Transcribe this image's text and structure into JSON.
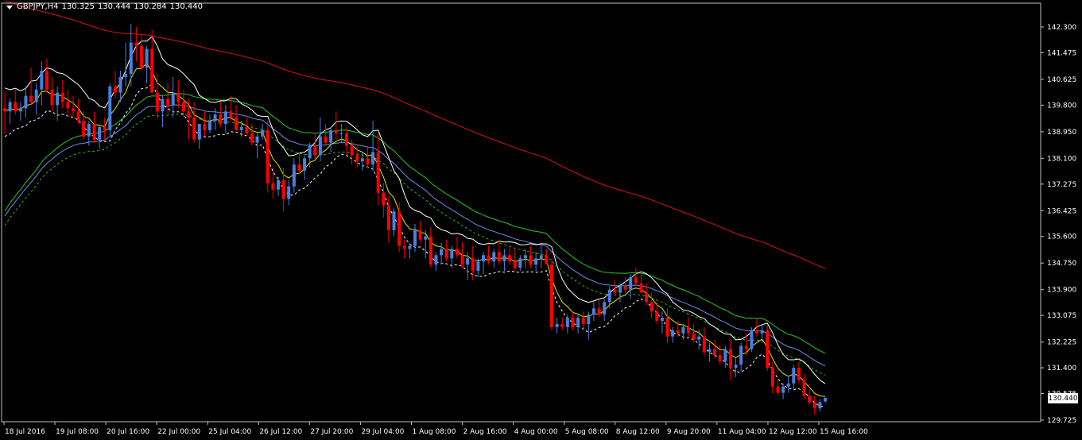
{
  "header": {
    "symbol": "GBPJPY,H4",
    "open": "130.325",
    "high": "130.444",
    "low": "130.284",
    "close": "130.440"
  },
  "current_price": "130.440",
  "chart_data": {
    "type": "candlestick",
    "y_ticks": [
      "142.300",
      "141.475",
      "140.625",
      "139.800",
      "138.950",
      "138.100",
      "137.275",
      "136.425",
      "135.600",
      "134.750",
      "133.900",
      "133.075",
      "132.225",
      "131.400",
      "130.575",
      "129.725"
    ],
    "x_ticks": [
      "18 Jul 2016",
      "19 Jul 08:00",
      "20 Jul 16:00",
      "22 Jul 00:00",
      "25 Jul 04:00",
      "26 Jul 12:00",
      "27 Jul 20:00",
      "29 Jul 04:00",
      "1 Aug 08:00",
      "2 Aug 16:00",
      "4 Aug 00:00",
      "5 Aug 08:00",
      "8 Aug 12:00",
      "9 Aug 20:00",
      "11 Aug 04:00",
      "12 Aug 12:00",
      "15 Aug 16:00"
    ],
    "ylim": [
      129.725,
      142.3
    ],
    "colors": {
      "bull": "#4a7fe0",
      "bear": "#ff0000",
      "ma_red": "#e01010",
      "ma_green": "#22cc22",
      "ma_blue": "#6a8fe0",
      "ma_green_dashed": "#22bb22",
      "ma_white": "#ffffff",
      "ma_yellow": "#e6e600",
      "ma_white_dashed": "#ffffff",
      "background": "#000000",
      "axis": "#ffffff"
    },
    "candles": [
      [
        139.7,
        140.2,
        138.9,
        139.6
      ],
      [
        139.6,
        140.0,
        139.2,
        139.9
      ],
      [
        139.9,
        140.3,
        139.5,
        139.6
      ],
      [
        139.6,
        139.9,
        139.3,
        139.7
      ],
      [
        139.7,
        140.4,
        139.4,
        140.1
      ],
      [
        140.1,
        141.0,
        139.8,
        139.9
      ],
      [
        139.9,
        140.5,
        139.5,
        140.3
      ],
      [
        140.3,
        141.2,
        139.8,
        140.9
      ],
      [
        140.9,
        141.3,
        140.2,
        140.3
      ],
      [
        140.3,
        140.7,
        139.6,
        139.8
      ],
      [
        139.8,
        140.4,
        139.3,
        140.2
      ],
      [
        140.2,
        140.6,
        139.7,
        139.9
      ],
      [
        139.9,
        140.3,
        139.4,
        139.7
      ],
      [
        139.7,
        140.1,
        139.4,
        139.6
      ],
      [
        139.6,
        140.0,
        139.2,
        139.3
      ],
      [
        139.3,
        139.6,
        138.7,
        138.8
      ],
      [
        138.8,
        139.3,
        138.5,
        139.2
      ],
      [
        139.2,
        139.6,
        138.6,
        138.7
      ],
      [
        138.7,
        139.2,
        138.4,
        139.1
      ],
      [
        139.1,
        139.4,
        138.7,
        139.0
      ],
      [
        139.0,
        140.5,
        138.8,
        140.4
      ],
      [
        140.4,
        140.9,
        140.0,
        140.2
      ],
      [
        140.2,
        140.9,
        139.9,
        140.7
      ],
      [
        140.7,
        141.8,
        140.4,
        140.8
      ],
      [
        140.8,
        142.4,
        140.4,
        141.8
      ],
      [
        141.8,
        142.3,
        141.2,
        141.7
      ],
      [
        141.7,
        142.1,
        140.9,
        141.0
      ],
      [
        141.0,
        141.7,
        140.5,
        141.6
      ],
      [
        141.6,
        142.2,
        140.9,
        140.2
      ],
      [
        140.2,
        140.8,
        139.4,
        139.6
      ],
      [
        139.6,
        140.1,
        139.1,
        140.0
      ],
      [
        140.0,
        140.5,
        139.5,
        139.8
      ],
      [
        139.8,
        140.7,
        139.4,
        140.2
      ],
      [
        140.2,
        140.6,
        139.7,
        139.9
      ],
      [
        139.9,
        140.3,
        139.4,
        139.6
      ],
      [
        139.6,
        140.0,
        138.7,
        139.4
      ],
      [
        139.4,
        139.9,
        138.6,
        138.7
      ],
      [
        138.7,
        139.1,
        138.4,
        139.2
      ],
      [
        139.2,
        139.6,
        138.8,
        139.0
      ],
      [
        139.0,
        139.5,
        138.9,
        139.3
      ],
      [
        139.3,
        139.7,
        139.0,
        139.5
      ],
      [
        139.5,
        139.9,
        139.1,
        139.2
      ],
      [
        139.2,
        139.8,
        138.9,
        139.6
      ],
      [
        139.6,
        140.1,
        139.3,
        139.4
      ],
      [
        139.4,
        139.8,
        139.0,
        139.0
      ],
      [
        139.0,
        139.3,
        138.8,
        139.1
      ],
      [
        139.1,
        139.4,
        138.8,
        138.9
      ],
      [
        138.9,
        139.2,
        138.5,
        138.6
      ],
      [
        138.6,
        138.9,
        138.1,
        138.8
      ],
      [
        138.8,
        139.2,
        138.7,
        139.0
      ],
      [
        139.0,
        139.3,
        137.0,
        137.3
      ],
      [
        137.3,
        137.8,
        136.8,
        137.1
      ],
      [
        137.1,
        137.5,
        136.9,
        137.4
      ],
      [
        137.4,
        137.8,
        136.4,
        136.8
      ],
      [
        136.8,
        137.4,
        136.6,
        137.2
      ],
      [
        137.2,
        138.1,
        137.0,
        137.9
      ],
      [
        137.9,
        138.3,
        137.6,
        137.7
      ],
      [
        137.7,
        138.2,
        137.4,
        138.1
      ],
      [
        138.1,
        138.6,
        137.8,
        138.5
      ],
      [
        138.5,
        138.9,
        138.0,
        138.2
      ],
      [
        138.2,
        139.4,
        138.0,
        138.8
      ],
      [
        138.8,
        139.2,
        138.5,
        138.6
      ],
      [
        138.6,
        139.1,
        138.3,
        139.0
      ],
      [
        139.0,
        139.6,
        138.7,
        138.9
      ],
      [
        138.9,
        139.2,
        138.6,
        138.9
      ],
      [
        138.9,
        139.1,
        138.2,
        138.5
      ],
      [
        138.5,
        138.7,
        137.9,
        138.2
      ],
      [
        138.2,
        138.5,
        137.8,
        138.0
      ],
      [
        138.0,
        138.3,
        137.7,
        138.1
      ],
      [
        138.1,
        138.5,
        137.8,
        137.9
      ],
      [
        137.9,
        139.3,
        137.7,
        138.3
      ],
      [
        138.3,
        138.9,
        136.6,
        137.0
      ],
      [
        137.0,
        137.3,
        136.2,
        136.6
      ],
      [
        136.6,
        136.9,
        135.4,
        135.8
      ],
      [
        135.8,
        136.5,
        135.6,
        136.4
      ],
      [
        136.4,
        136.7,
        135.1,
        135.3
      ],
      [
        135.3,
        135.5,
        134.9,
        135.2
      ],
      [
        135.2,
        135.4,
        134.9,
        135.3
      ],
      [
        135.3,
        136.0,
        135.1,
        135.8
      ],
      [
        135.8,
        136.1,
        135.4,
        135.5
      ],
      [
        135.5,
        135.8,
        134.9,
        135.6
      ],
      [
        135.6,
        135.9,
        134.6,
        134.7
      ],
      [
        134.7,
        135.1,
        134.5,
        135.0
      ],
      [
        135.0,
        135.4,
        134.7,
        135.2
      ],
      [
        135.2,
        135.5,
        134.8,
        134.9
      ],
      [
        134.9,
        135.3,
        134.6,
        135.2
      ],
      [
        135.2,
        135.6,
        134.9,
        135.0
      ],
      [
        135.0,
        135.4,
        134.6,
        134.7
      ],
      [
        134.7,
        135.1,
        134.2,
        134.9
      ],
      [
        134.9,
        135.3,
        134.2,
        134.5
      ],
      [
        134.5,
        134.9,
        134.3,
        134.8
      ],
      [
        134.8,
        135.1,
        134.4,
        135.0
      ],
      [
        135.0,
        135.3,
        134.7,
        134.8
      ],
      [
        134.8,
        135.2,
        134.6,
        135.1
      ],
      [
        135.1,
        135.5,
        134.7,
        134.8
      ],
      [
        134.8,
        135.2,
        134.5,
        135.0
      ],
      [
        135.0,
        135.3,
        134.7,
        134.8
      ],
      [
        134.8,
        135.2,
        134.5,
        134.6
      ],
      [
        134.6,
        135.0,
        134.5,
        134.9
      ],
      [
        134.9,
        135.2,
        134.6,
        135.0
      ],
      [
        135.0,
        135.3,
        134.6,
        134.7
      ],
      [
        134.7,
        135.1,
        134.5,
        134.9
      ],
      [
        134.9,
        135.3,
        134.6,
        135.0
      ],
      [
        135.0,
        135.2,
        134.7,
        134.7
      ],
      [
        134.7,
        134.9,
        132.6,
        132.7
      ],
      [
        132.7,
        133.0,
        132.5,
        132.8
      ],
      [
        132.8,
        133.0,
        132.6,
        132.7
      ],
      [
        132.7,
        133.1,
        132.5,
        133.0
      ],
      [
        133.0,
        133.2,
        132.6,
        132.7
      ],
      [
        132.7,
        133.1,
        132.5,
        133.0
      ],
      [
        133.0,
        133.2,
        132.6,
        132.8
      ],
      [
        132.8,
        133.2,
        132.3,
        133.1
      ],
      [
        133.1,
        133.5,
        132.9,
        133.3
      ],
      [
        133.3,
        133.6,
        133.0,
        133.1
      ],
      [
        133.1,
        133.6,
        132.9,
        133.5
      ],
      [
        133.5,
        134.0,
        133.3,
        133.9
      ],
      [
        133.9,
        134.2,
        133.7,
        133.8
      ],
      [
        133.8,
        134.1,
        133.5,
        134.0
      ],
      [
        134.0,
        134.3,
        133.8,
        133.9
      ],
      [
        133.9,
        134.4,
        133.6,
        134.3
      ],
      [
        134.3,
        134.6,
        134.0,
        134.1
      ],
      [
        134.1,
        134.5,
        133.9,
        133.8
      ],
      [
        133.8,
        134.1,
        133.4,
        133.5
      ],
      [
        133.5,
        133.8,
        133.0,
        133.2
      ],
      [
        133.2,
        133.5,
        132.8,
        132.9
      ],
      [
        132.9,
        133.2,
        132.5,
        133.0
      ],
      [
        133.0,
        133.3,
        132.2,
        132.4
      ],
      [
        132.4,
        132.7,
        132.2,
        132.6
      ],
      [
        132.6,
        132.9,
        132.4,
        132.5
      ],
      [
        132.5,
        132.8,
        132.3,
        132.7
      ],
      [
        132.7,
        133.0,
        132.4,
        132.5
      ],
      [
        132.5,
        132.8,
        132.2,
        132.3
      ],
      [
        132.3,
        132.6,
        132.0,
        132.4
      ],
      [
        132.4,
        132.7,
        131.8,
        131.9
      ],
      [
        131.9,
        132.2,
        131.6,
        132.0
      ],
      [
        132.0,
        132.3,
        131.7,
        131.8
      ],
      [
        131.8,
        132.1,
        131.5,
        131.6
      ],
      [
        131.6,
        132.1,
        131.4,
        132.0
      ],
      [
        132.0,
        132.3,
        131.0,
        131.4
      ],
      [
        131.4,
        131.7,
        131.1,
        131.5
      ],
      [
        131.5,
        132.2,
        131.3,
        132.1
      ],
      [
        132.1,
        132.5,
        131.8,
        132.0
      ],
      [
        132.0,
        132.7,
        131.9,
        132.6
      ],
      [
        132.6,
        133.0,
        132.4,
        132.5
      ],
      [
        132.5,
        132.8,
        132.2,
        132.6
      ],
      [
        132.6,
        132.8,
        131.3,
        131.4
      ],
      [
        131.4,
        131.6,
        130.6,
        130.8
      ],
      [
        130.8,
        131.0,
        130.5,
        130.6
      ],
      [
        130.6,
        130.9,
        130.4,
        130.8
      ],
      [
        130.8,
        131.1,
        130.6,
        130.9
      ],
      [
        130.9,
        131.5,
        130.7,
        131.4
      ],
      [
        131.4,
        131.6,
        130.9,
        131.0
      ],
      [
        131.0,
        131.2,
        130.4,
        130.5
      ],
      [
        130.5,
        130.8,
        130.2,
        130.3
      ],
      [
        130.3,
        130.5,
        129.9,
        130.1
      ],
      [
        130.1,
        130.4,
        130.0,
        130.3
      ],
      [
        130.325,
        130.444,
        130.284,
        130.44
      ]
    ]
  }
}
